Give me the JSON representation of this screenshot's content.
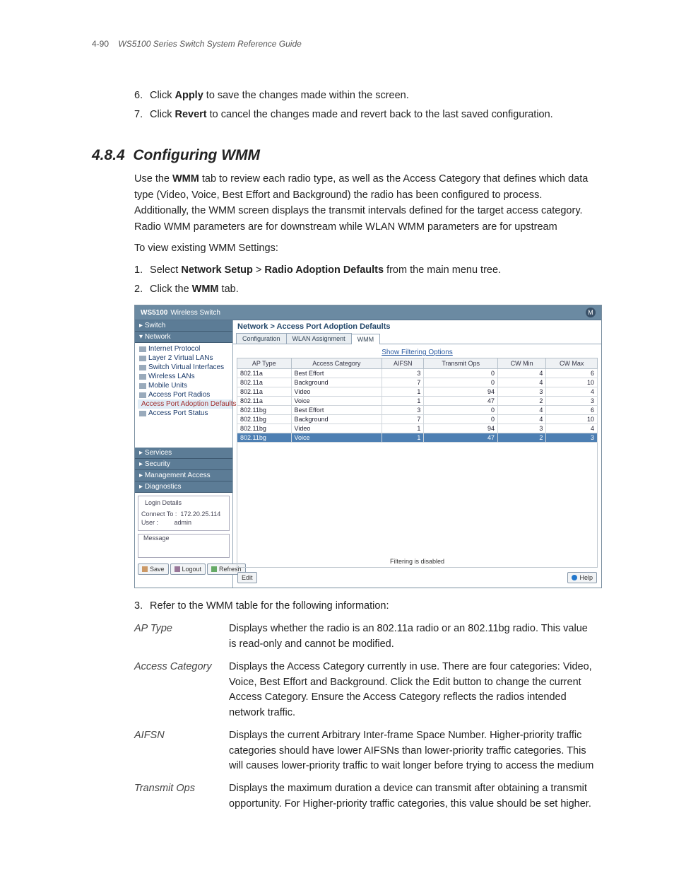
{
  "header": {
    "page_number": "4-90",
    "guide": "WS5100 Series Switch System Reference Guide"
  },
  "pre_steps": [
    {
      "n": "6.",
      "pre": "Click ",
      "bold": "Apply",
      "post": " to save the changes made within the screen."
    },
    {
      "n": "7.",
      "pre": "Click ",
      "bold": "Revert",
      "post": " to cancel the changes made and revert back to the last saved configuration."
    }
  ],
  "section": {
    "number": "4.8.4",
    "title": "Configuring WMM",
    "intro_pre": "Use the ",
    "intro_bold": "WMM",
    "intro_post": " tab to review each radio type, as well as the Access Category that defines which data type (Video, Voice, Best Effort and Background) the radio has been configured to process. Additionally, the WMM screen displays the transmit intervals defined for the target access category. Radio WMM parameters are for downstream while WLAN WMM parameters are for upstream",
    "lead_in": "To view existing WMM Settings:",
    "steps": {
      "s1": {
        "n": "1.",
        "pre": "Select ",
        "b1": "Network Setup",
        "mid": " > ",
        "b2": "Radio Adoption Defaults",
        "post": " from the main menu tree."
      },
      "s2": {
        "n": "2.",
        "pre": "Click the ",
        "b1": "WMM",
        "post": " tab."
      },
      "s3": {
        "n": "3.",
        "text": "Refer to the WMM table for the following information:"
      }
    }
  },
  "app": {
    "brand_bold": "WS5100",
    "brand_light": "Wireless Switch",
    "breadcrumb": "Network > Access Port Adoption Defaults",
    "tabs": [
      "Configuration",
      "WLAN Assignment",
      "WMM"
    ],
    "active_tab": 2,
    "filter_link": "Show Filtering Options",
    "filter_status": "Filtering is disabled",
    "sidebar": {
      "cats": [
        "Switch",
        "Network",
        "Services",
        "Security",
        "Management Access",
        "Diagnostics"
      ],
      "network_items": [
        "Internet Protocol",
        "Layer 2 Virtual LANs",
        "Switch Virtual Interfaces",
        "Wireless LANs",
        "Mobile Units",
        "Access Port Radios",
        "Access Port Adoption Defaults",
        "Access Port Status"
      ],
      "selected": "Access Port Adoption Defaults"
    },
    "login": {
      "title": "Login Details",
      "connect_label": "Connect To :",
      "connect_val": "172.20.25.114",
      "user_label": "User :",
      "user_val": "admin"
    },
    "message_title": "Message",
    "side_btns": {
      "save": "Save",
      "logout": "Logout",
      "refresh": "Refresh"
    },
    "footer_btns": {
      "edit": "Edit",
      "help": "Help"
    },
    "table": {
      "headers": [
        "AP Type",
        "Access Category",
        "AIFSN",
        "Transmit Ops",
        "CW Min",
        "CW Max"
      ],
      "rows": [
        [
          "802.11a",
          "Best Effort",
          "3",
          "0",
          "4",
          "6"
        ],
        [
          "802.11a",
          "Background",
          "7",
          "0",
          "4",
          "10"
        ],
        [
          "802.11a",
          "Video",
          "1",
          "94",
          "3",
          "4"
        ],
        [
          "802.11a",
          "Voice",
          "1",
          "47",
          "2",
          "3"
        ],
        [
          "802.11bg",
          "Best Effort",
          "3",
          "0",
          "4",
          "6"
        ],
        [
          "802.11bg",
          "Background",
          "7",
          "0",
          "4",
          "10"
        ],
        [
          "802.11bg",
          "Video",
          "1",
          "94",
          "3",
          "4"
        ],
        [
          "802.11bg",
          "Voice",
          "1",
          "47",
          "2",
          "3"
        ]
      ],
      "selected_row": 7
    }
  },
  "defs": [
    {
      "term": "AP Type",
      "body": "Displays whether the radio is an 802.11a radio or an 802.11bg radio. This value is read-only and cannot be modified."
    },
    {
      "term": "Access Category",
      "body": "Displays the Access Category currently in use. There are four categories: Video, Voice, Best Effort and Background. Click the Edit button to change the current Access Category. Ensure the Access Category reflects the radios intended network traffic."
    },
    {
      "term": "AIFSN",
      "body": "Displays the current Arbitrary Inter-frame Space Number. Higher-priority traffic categories should have lower AIFSNs than lower-priority traffic categories. This will causes lower-priority traffic to wait longer before trying to access the medium"
    },
    {
      "term": "Transmit Ops",
      "body": "Displays the maximum duration a device can transmit after obtaining a transmit opportunity. For Higher-priority traffic categories, this value should be set higher."
    }
  ]
}
